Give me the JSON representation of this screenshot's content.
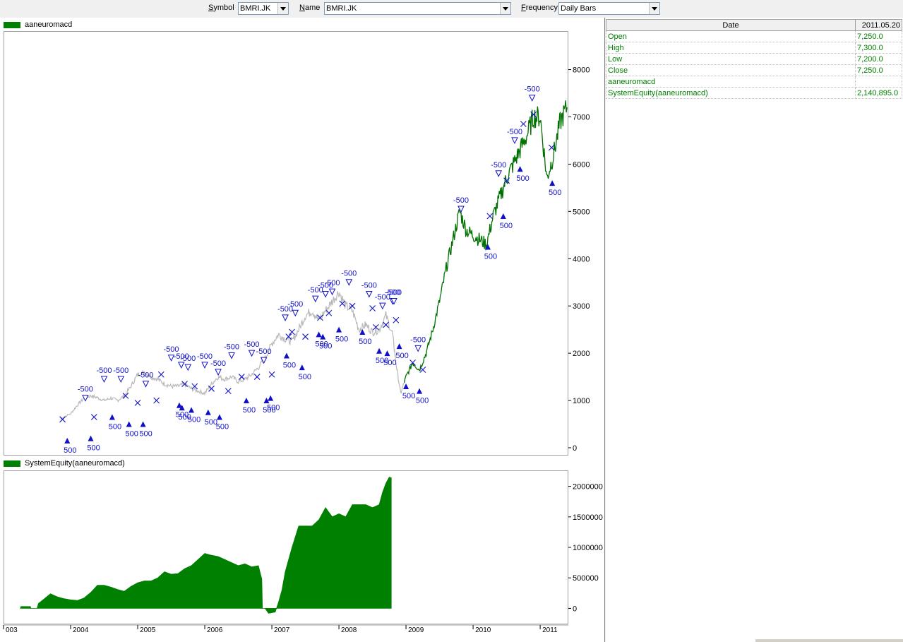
{
  "toolbar": {
    "symbol_label_u": "S",
    "symbol_label_rest": "ymbol",
    "symbol_value": "BMRI.JK",
    "name_label_u": "N",
    "name_label_rest": "ame",
    "name_value": "BMRI.JK",
    "frequency_label_u": "F",
    "frequency_label_rest": "requency",
    "frequency_value": "Daily Bars"
  },
  "data_panel": {
    "header_label": "Date",
    "header_value": "2011.05.20",
    "rows": [
      {
        "label": "Open",
        "value": "7,250.0"
      },
      {
        "label": "High",
        "value": "7,300.0"
      },
      {
        "label": "Low",
        "value": "7,200.0"
      },
      {
        "label": "Close",
        "value": "7,250.0"
      },
      {
        "label": "aaneuromacd",
        "value": ""
      },
      {
        "label": "SystemEquity(aaneuromacd)",
        "value": "2,140,895.0"
      }
    ]
  },
  "colors": {
    "price_out": "#b8b8b8",
    "price_in": "#007000",
    "marker": "#1010c8",
    "equity": "#008000"
  },
  "chart_data": [
    {
      "type": "line",
      "title": "aaneuromacd",
      "series_name": "aaneuromacd",
      "ylim": [
        -150,
        8800
      ],
      "yticks": [
        0,
        1000,
        2000,
        3000,
        4000,
        5000,
        6000,
        7000,
        8000
      ],
      "price": [
        [
          2003.85,
          620
        ],
        [
          2004.0,
          720
        ],
        [
          2004.1,
          900
        ],
        [
          2004.2,
          1050
        ],
        [
          2004.3,
          1100
        ],
        [
          2004.4,
          1060
        ],
        [
          2004.5,
          1000
        ],
        [
          2004.6,
          1050
        ],
        [
          2004.7,
          1000
        ],
        [
          2004.8,
          1100
        ],
        [
          2004.9,
          1300
        ],
        [
          2005.0,
          1550
        ],
        [
          2005.1,
          1600
        ],
        [
          2005.2,
          1500
        ],
        [
          2005.3,
          1450
        ],
        [
          2005.4,
          1350
        ],
        [
          2005.5,
          1300
        ],
        [
          2005.6,
          1300
        ],
        [
          2005.7,
          1350
        ],
        [
          2005.8,
          1250
        ],
        [
          2005.9,
          1200
        ],
        [
          2006.0,
          1150
        ],
        [
          2006.1,
          1350
        ],
        [
          2006.2,
          1500
        ],
        [
          2006.3,
          1450
        ],
        [
          2006.4,
          1500
        ],
        [
          2006.5,
          1400
        ],
        [
          2006.6,
          1450
        ],
        [
          2006.7,
          1550
        ],
        [
          2006.8,
          1700
        ],
        [
          2006.9,
          1900
        ],
        [
          2007.0,
          2200
        ],
        [
          2007.1,
          2400
        ],
        [
          2007.2,
          2300
        ],
        [
          2007.3,
          2250
        ],
        [
          2007.4,
          2500
        ],
        [
          2007.5,
          2800
        ],
        [
          2007.6,
          2900
        ],
        [
          2007.7,
          2700
        ],
        [
          2007.8,
          2900
        ],
        [
          2007.9,
          3100
        ],
        [
          2008.0,
          3300
        ],
        [
          2008.1,
          3000
        ],
        [
          2008.2,
          2900
        ],
        [
          2008.3,
          2500
        ],
        [
          2008.4,
          2600
        ],
        [
          2008.5,
          2450
        ],
        [
          2008.6,
          2500
        ],
        [
          2008.7,
          2800
        ],
        [
          2008.8,
          2400
        ],
        [
          2008.85,
          1800
        ],
        [
          2008.92,
          1150
        ],
        [
          2009.0,
          1500
        ],
        [
          2009.1,
          1800
        ],
        [
          2009.2,
          1650
        ],
        [
          2009.3,
          2000
        ],
        [
          2009.4,
          2500
        ],
        [
          2009.5,
          3100
        ],
        [
          2009.6,
          3800
        ],
        [
          2009.7,
          4400
        ],
        [
          2009.8,
          5000
        ],
        [
          2009.9,
          4600
        ],
        [
          2010.0,
          4500
        ],
        [
          2010.1,
          4400
        ],
        [
          2010.2,
          4300
        ],
        [
          2010.3,
          4900
        ],
        [
          2010.4,
          5300
        ],
        [
          2010.5,
          5700
        ],
        [
          2010.6,
          6000
        ],
        [
          2010.7,
          6300
        ],
        [
          2010.8,
          6600
        ],
        [
          2010.9,
          7000
        ],
        [
          2011.0,
          7000
        ],
        [
          2011.1,
          5700
        ],
        [
          2011.2,
          6200
        ],
        [
          2011.3,
          6900
        ],
        [
          2011.4,
          7200
        ]
      ],
      "active_from": 2008.97,
      "trades": [
        {
          "x": 2003.95,
          "y": 150,
          "t": "buy",
          "q": "500"
        },
        {
          "x": 2003.88,
          "y": 600,
          "t": "sell"
        },
        {
          "x": 2004.22,
          "y": 1050,
          "t": "sell",
          "q": "-500"
        },
        {
          "x": 2004.3,
          "y": 200,
          "t": "buy",
          "q": "500"
        },
        {
          "x": 2004.35,
          "y": 650,
          "t": "sell"
        },
        {
          "x": 2004.5,
          "y": 1450,
          "t": "sell",
          "q": "-500"
        },
        {
          "x": 2004.62,
          "y": 650,
          "t": "buy",
          "q": "500"
        },
        {
          "x": 2004.75,
          "y": 1450,
          "t": "sell",
          "q": "-500"
        },
        {
          "x": 2004.82,
          "y": 1100,
          "t": "sell"
        },
        {
          "x": 2004.87,
          "y": 500,
          "t": "buy",
          "q": "500"
        },
        {
          "x": 2005.0,
          "y": 950,
          "t": "sell"
        },
        {
          "x": 2005.08,
          "y": 500,
          "t": "buy",
          "q": "500"
        },
        {
          "x": 2005.12,
          "y": 1350,
          "t": "sell",
          "q": "-500"
        },
        {
          "x": 2005.28,
          "y": 1000,
          "t": "sell"
        },
        {
          "x": 2005.35,
          "y": 1550,
          "t": "sell"
        },
        {
          "x": 2005.5,
          "y": 1900,
          "t": "sell",
          "q": "-500"
        },
        {
          "x": 2005.62,
          "y": 900,
          "t": "buy",
          "q": "500"
        },
        {
          "x": 2005.65,
          "y": 1750,
          "t": "sell",
          "q": "-500"
        },
        {
          "x": 2005.66,
          "y": 850,
          "t": "buy",
          "q": "500"
        },
        {
          "x": 2005.7,
          "y": 1350,
          "t": "sell"
        },
        {
          "x": 2005.75,
          "y": 1700,
          "t": "sell",
          "q": "-500"
        },
        {
          "x": 2005.8,
          "y": 800,
          "t": "buy",
          "q": "500"
        },
        {
          "x": 2005.85,
          "y": 1300,
          "t": "sell"
        },
        {
          "x": 2006.0,
          "y": 1750,
          "t": "sell",
          "q": "-500"
        },
        {
          "x": 2006.05,
          "y": 750,
          "t": "buy",
          "q": "500"
        },
        {
          "x": 2006.1,
          "y": 1250,
          "t": "sell"
        },
        {
          "x": 2006.2,
          "y": 1600,
          "t": "sell",
          "q": "-500"
        },
        {
          "x": 2006.22,
          "y": 650,
          "t": "buy",
          "q": "500"
        },
        {
          "x": 2006.35,
          "y": 1200,
          "t": "sell"
        },
        {
          "x": 2006.4,
          "y": 1950,
          "t": "sell",
          "q": "-500"
        },
        {
          "x": 2006.55,
          "y": 1500,
          "t": "sell"
        },
        {
          "x": 2006.62,
          "y": 1000,
          "t": "buy",
          "q": "500"
        },
        {
          "x": 2006.7,
          "y": 2000,
          "t": "sell",
          "q": "-500"
        },
        {
          "x": 2006.78,
          "y": 1500,
          "t": "sell"
        },
        {
          "x": 2006.88,
          "y": 1850,
          "t": "sell",
          "q": "-500"
        },
        {
          "x": 2006.92,
          "y": 1000,
          "t": "buy",
          "q": "500"
        },
        {
          "x": 2006.98,
          "y": 1050,
          "t": "buy",
          "q": "500"
        },
        {
          "x": 2007.0,
          "y": 1550,
          "t": "sell"
        },
        {
          "x": 2007.2,
          "y": 2750,
          "t": "sell",
          "q": "-500"
        },
        {
          "x": 2007.22,
          "y": 1950,
          "t": "buy",
          "q": "500"
        },
        {
          "x": 2007.25,
          "y": 2350,
          "t": "sell"
        },
        {
          "x": 2007.3,
          "y": 2450,
          "t": "sell"
        },
        {
          "x": 2007.35,
          "y": 2850,
          "t": "sell",
          "q": "-500"
        },
        {
          "x": 2007.45,
          "y": 1700,
          "t": "buy",
          "q": "500"
        },
        {
          "x": 2007.5,
          "y": 2350,
          "t": "sell"
        },
        {
          "x": 2007.65,
          "y": 3150,
          "t": "sell",
          "q": "-500"
        },
        {
          "x": 2007.7,
          "y": 2400,
          "t": "buy",
          "q": "500"
        },
        {
          "x": 2007.72,
          "y": 2750,
          "t": "sell"
        },
        {
          "x": 2007.76,
          "y": 2350,
          "t": "buy",
          "q": "500"
        },
        {
          "x": 2007.8,
          "y": 3250,
          "t": "sell",
          "q": "-500"
        },
        {
          "x": 2007.85,
          "y": 2850,
          "t": "sell"
        },
        {
          "x": 2007.9,
          "y": 3300,
          "t": "sell",
          "q": "-500"
        },
        {
          "x": 2008.0,
          "y": 2500,
          "t": "buy",
          "q": "500"
        },
        {
          "x": 2008.05,
          "y": 3050,
          "t": "sell"
        },
        {
          "x": 2008.15,
          "y": 3500,
          "t": "sell",
          "q": "-500"
        },
        {
          "x": 2008.2,
          "y": 3000,
          "t": "sell"
        },
        {
          "x": 2008.35,
          "y": 2450,
          "t": "buy",
          "q": "500"
        },
        {
          "x": 2008.45,
          "y": 3250,
          "t": "sell",
          "q": "-500"
        },
        {
          "x": 2008.5,
          "y": 2950,
          "t": "sell"
        },
        {
          "x": 2008.55,
          "y": 2550,
          "t": "sell"
        },
        {
          "x": 2008.6,
          "y": 2050,
          "t": "buy",
          "q": "500"
        },
        {
          "x": 2008.65,
          "y": 3000,
          "t": "sell",
          "q": "-500"
        },
        {
          "x": 2008.7,
          "y": 2600,
          "t": "sell"
        },
        {
          "x": 2008.72,
          "y": 2000,
          "t": "buy",
          "q": "500"
        },
        {
          "x": 2008.8,
          "y": 3100,
          "t": "sell",
          "q": "-500"
        },
        {
          "x": 2008.82,
          "y": 3100,
          "t": "sell",
          "q": "-500"
        },
        {
          "x": 2008.85,
          "y": 2700,
          "t": "sell"
        },
        {
          "x": 2008.9,
          "y": 2150,
          "t": "buy",
          "q": "500"
        },
        {
          "x": 2009.0,
          "y": 1300,
          "t": "buy",
          "q": "500"
        },
        {
          "x": 2009.1,
          "y": 1800,
          "t": "sell"
        },
        {
          "x": 2009.18,
          "y": 2100,
          "t": "sell",
          "q": "-500"
        },
        {
          "x": 2009.2,
          "y": 1200,
          "t": "buy",
          "q": "500"
        },
        {
          "x": 2009.25,
          "y": 1650,
          "t": "sell"
        },
        {
          "x": 2009.82,
          "y": 5050,
          "t": "sell",
          "q": "-500"
        },
        {
          "x": 2010.22,
          "y": 4250,
          "t": "buy",
          "q": "500"
        },
        {
          "x": 2010.25,
          "y": 4900,
          "t": "sell"
        },
        {
          "x": 2010.38,
          "y": 5800,
          "t": "sell",
          "q": "-500"
        },
        {
          "x": 2010.45,
          "y": 4900,
          "t": "buy",
          "q": "500"
        },
        {
          "x": 2010.5,
          "y": 5650,
          "t": "sell"
        },
        {
          "x": 2010.62,
          "y": 6500,
          "t": "sell",
          "q": "-500"
        },
        {
          "x": 2010.7,
          "y": 5900,
          "t": "buy",
          "q": "500"
        },
        {
          "x": 2010.75,
          "y": 6850,
          "t": "sell"
        },
        {
          "x": 2010.88,
          "y": 7400,
          "t": "sell",
          "q": "-500"
        },
        {
          "x": 2010.9,
          "y": 7050,
          "t": "sell"
        },
        {
          "x": 2011.17,
          "y": 6350,
          "t": "sell"
        },
        {
          "x": 2011.18,
          "y": 5600,
          "t": "buy",
          "q": "500"
        }
      ]
    },
    {
      "type": "area",
      "title": "SystemEquity(aaneuromacd)",
      "series_name": "SystemEquity(aaneuromacd)",
      "ylim": [
        -250000,
        2250000
      ],
      "yticks": [
        0,
        500000,
        1000000,
        1500000,
        2000000
      ],
      "ytick_labels": [
        "0",
        "500000",
        "1000000",
        "1500000",
        "2000000"
      ],
      "xlim": [
        2003.0,
        2011.42
      ],
      "xticks": [
        2003,
        2004,
        2005,
        2006,
        2007,
        2008,
        2009,
        2010,
        2011
      ],
      "xtick_labels": [
        "003",
        "2004",
        "2005",
        "2006",
        "2007",
        "2008",
        "2009",
        "2010",
        "2011"
      ],
      "equity": [
        [
          2003.25,
          0
        ],
        [
          2003.26,
          30000
        ],
        [
          2003.4,
          30000
        ],
        [
          2003.41,
          0
        ],
        [
          2003.5,
          0
        ],
        [
          2003.52,
          80000
        ],
        [
          2003.6,
          150000
        ],
        [
          2003.7,
          240000
        ],
        [
          2003.8,
          190000
        ],
        [
          2003.9,
          160000
        ],
        [
          2004.0,
          140000
        ],
        [
          2004.1,
          130000
        ],
        [
          2004.2,
          170000
        ],
        [
          2004.3,
          260000
        ],
        [
          2004.4,
          380000
        ],
        [
          2004.5,
          380000
        ],
        [
          2004.6,
          350000
        ],
        [
          2004.7,
          310000
        ],
        [
          2004.8,
          280000
        ],
        [
          2004.9,
          360000
        ],
        [
          2005.0,
          420000
        ],
        [
          2005.1,
          450000
        ],
        [
          2005.2,
          450000
        ],
        [
          2005.3,
          500000
        ],
        [
          2005.4,
          600000
        ],
        [
          2005.5,
          560000
        ],
        [
          2005.6,
          570000
        ],
        [
          2005.7,
          650000
        ],
        [
          2005.8,
          700000
        ],
        [
          2005.9,
          800000
        ],
        [
          2006.0,
          900000
        ],
        [
          2006.1,
          870000
        ],
        [
          2006.2,
          850000
        ],
        [
          2006.3,
          800000
        ],
        [
          2006.4,
          750000
        ],
        [
          2006.5,
          700000
        ],
        [
          2006.6,
          730000
        ],
        [
          2006.7,
          680000
        ],
        [
          2006.8,
          700000
        ],
        [
          2006.85,
          480000
        ],
        [
          2006.86,
          0
        ],
        [
          2006.9,
          0
        ],
        [
          2006.95,
          -80000
        ],
        [
          2007.05,
          -60000
        ],
        [
          2007.1,
          100000
        ],
        [
          2007.15,
          300000
        ],
        [
          2007.2,
          600000
        ],
        [
          2007.3,
          1000000
        ],
        [
          2007.4,
          1350000
        ],
        [
          2007.5,
          1350000
        ],
        [
          2007.6,
          1350000
        ],
        [
          2007.7,
          1450000
        ],
        [
          2007.8,
          1650000
        ],
        [
          2007.9,
          1500000
        ],
        [
          2008.0,
          1550000
        ],
        [
          2008.1,
          1500000
        ],
        [
          2008.2,
          1700000
        ],
        [
          2008.3,
          1700000
        ],
        [
          2008.4,
          1700000
        ],
        [
          2008.5,
          1650000
        ],
        [
          2008.6,
          1700000
        ],
        [
          2008.65,
          1900000
        ],
        [
          2008.7,
          2050000
        ],
        [
          2008.75,
          2150000
        ],
        [
          2008.78,
          2140000
        ]
      ]
    }
  ]
}
